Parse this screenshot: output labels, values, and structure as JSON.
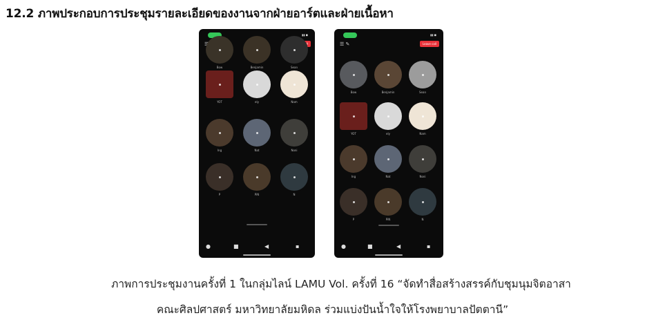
{
  "heading": "12.2 ภาพประกอบการประชุมรายละเอียดของงานจากฝ่ายอาร์ตและฝ่ายเนื้อหา",
  "phones": [
    {
      "leave_label": "Leave call",
      "participants": [
        {
          "name": "Bow",
          "color": "#3a3328"
        },
        {
          "name": "Benjamin",
          "color": "#3b3226"
        },
        {
          "name": "Sean",
          "color": "#2e2e2e"
        },
        {
          "name": "YOT",
          "color": "#6a1f1c"
        },
        {
          "name": "ely",
          "color": "#d9d9d9"
        },
        {
          "name": "Nam",
          "color": "#efe5d6"
        },
        {
          "name": "Ing",
          "color": "#4b3a2c"
        },
        {
          "name": "Nat",
          "color": "#5d6675"
        },
        {
          "name": "Noni",
          "color": "#3f3e3a"
        },
        {
          "name": "P",
          "color": "#3a2f28"
        },
        {
          "name": "PiN",
          "color": "#4a3a2a"
        },
        {
          "name": "N",
          "color": "#2f3a40"
        }
      ]
    },
    {
      "leave_label": "Leave call",
      "participants": [
        {
          "name": "Bow",
          "color": "#585a5e"
        },
        {
          "name": "Benjamin",
          "color": "#5a4635"
        },
        {
          "name": "Sean",
          "color": "#9c9c9c"
        },
        {
          "name": "YOT",
          "color": "#6a1f1c"
        },
        {
          "name": "ely",
          "color": "#d9d9d9"
        },
        {
          "name": "Nam",
          "color": "#efe5d6"
        },
        {
          "name": "Ing",
          "color": "#4b3a2c"
        },
        {
          "name": "Nat",
          "color": "#5d6675"
        },
        {
          "name": "Noni",
          "color": "#3f3e3a"
        },
        {
          "name": "P",
          "color": "#3a2f28"
        },
        {
          "name": "PiN",
          "color": "#4a3a2a"
        },
        {
          "name": "N",
          "color": "#2f3a40"
        }
      ]
    }
  ],
  "caption_line1": "ภาพการประชุมงานครั้งที่ 1 ในกลุ่มไลน์ LAMU Vol. ครั้งที่ 16 “จัดทำสื่อสร้างสรรค์กับชุมนุมจิตอาสา",
  "caption_line2": "คณะศิลปศาสตร์ มหาวิทยาลัยมหิดล ร่วมแบ่งปันน้ำใจให้โรงพยาบาลปัตตานี”"
}
